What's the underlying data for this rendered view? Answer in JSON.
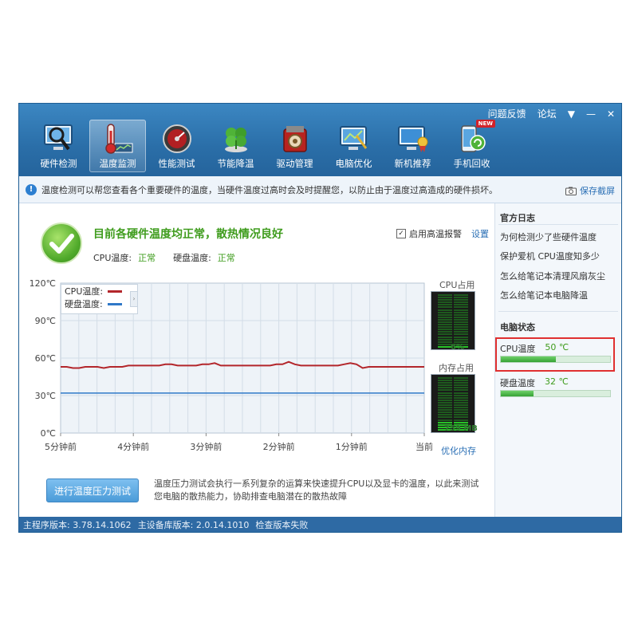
{
  "header": {
    "feedback": "问题反馈",
    "forum": "论坛",
    "menu_glyph": "▼",
    "minimize_glyph": "—",
    "close_glyph": "✕"
  },
  "nav": [
    {
      "label": "硬件检测",
      "icon": "magnifier-monitor-icon"
    },
    {
      "label": "温度监测",
      "icon": "thermometer-icon",
      "active": true
    },
    {
      "label": "性能测试",
      "icon": "speedometer-icon"
    },
    {
      "label": "节能降温",
      "icon": "leaf-clover-icon"
    },
    {
      "label": "驱动管理",
      "icon": "driver-gear-icon"
    },
    {
      "label": "电脑优化",
      "icon": "monitor-wand-icon"
    },
    {
      "label": "新机推荐",
      "icon": "monitor-medal-icon"
    },
    {
      "label": "手机回收",
      "icon": "phone-recycle-icon",
      "badge": "NEW"
    }
  ],
  "info": {
    "text": "温度检测可以帮您查看各个重要硬件的温度，当硬件温度过高时会及时提醒您，以防止由于温度过高造成的硬件损坏。",
    "save_screenshot": "保存截屏"
  },
  "status_summary": {
    "headline": "目前各硬件温度均正常，散热情况良好",
    "cpu_label": "CPU温度:",
    "cpu_value": "正常",
    "disk_label": "硬盘温度:",
    "disk_value": "正常",
    "alarm_label": "启用高温报警",
    "alarm_checked": true,
    "settings": "设置"
  },
  "chart_data": {
    "type": "line",
    "y_ticks": [
      "120℃",
      "90℃",
      "60℃",
      "30℃",
      "0℃"
    ],
    "x_ticks": [
      "5分钟前",
      "4分钟前",
      "3分钟前",
      "2分钟前",
      "1分钟前",
      "当前"
    ],
    "ylim": [
      0,
      120
    ],
    "grid": true,
    "legend_position": "top-left",
    "series": [
      {
        "name": "CPU温度:",
        "color": "#b3262b",
        "values": [
          53,
          53,
          52,
          52,
          53,
          53,
          53,
          52,
          53,
          53,
          53,
          54,
          54,
          54,
          54,
          54,
          54,
          55,
          55,
          54,
          54,
          54,
          54,
          55,
          55,
          56,
          54,
          54,
          54,
          54,
          54,
          54,
          54,
          54,
          54,
          55,
          55,
          57,
          55,
          54,
          54,
          54,
          54,
          54,
          54,
          54,
          55,
          56,
          55,
          52,
          53,
          53,
          53,
          53,
          53,
          53,
          53,
          53,
          53,
          53
        ]
      },
      {
        "name": "硬盘温度:",
        "color": "#2f78c8",
        "values": [
          32,
          32,
          32,
          32,
          32,
          32,
          32,
          32,
          32,
          32,
          32,
          32,
          32,
          32,
          32,
          32,
          32,
          32,
          32,
          32,
          32,
          32,
          32,
          32,
          32,
          32,
          32,
          32,
          32,
          32,
          32,
          32,
          32,
          32,
          32,
          32,
          32,
          32,
          32,
          32,
          32,
          32,
          32,
          32,
          32,
          32,
          32,
          32,
          32,
          32,
          32,
          32,
          32,
          32,
          32,
          32,
          32,
          32,
          32,
          32
        ]
      }
    ]
  },
  "meters": {
    "cpu_title": "CPU占用",
    "cpu_value": "6%",
    "cpu_fraction": 0.06,
    "mem_title": "内存占用",
    "mem_value": "759 MB",
    "mem_fraction": 0.2,
    "optimize_memory": "优化内存"
  },
  "stress": {
    "button": "进行温度压力测试",
    "description": "温度压力测试会执行一系列复杂的运算来快速提升CPU以及显卡的温度，以此来测试您电脑的散热能力，协助排查电脑潜在的散热故障"
  },
  "sidebar": {
    "log_title": "官方日志",
    "links": [
      "为何检测少了些硬件温度",
      "保护爱机 CPU温度知多少",
      "怎么给笔记本清理风扇灰尘",
      "怎么给笔记本电脑降温"
    ],
    "status_title": "电脑状态",
    "cpu_temp_label": "CPU温度",
    "cpu_temp_value": "50 ℃",
    "cpu_temp_fraction": 0.5,
    "disk_temp_label": "硬盘温度",
    "disk_temp_value": "32 ℃",
    "disk_temp_fraction": 0.3
  },
  "statusbar": {
    "main_version": "主程序版本: 3.78.14.1062",
    "db_version": "主设备库版本: 2.0.14.1010",
    "update_status": "检查版本失败"
  }
}
